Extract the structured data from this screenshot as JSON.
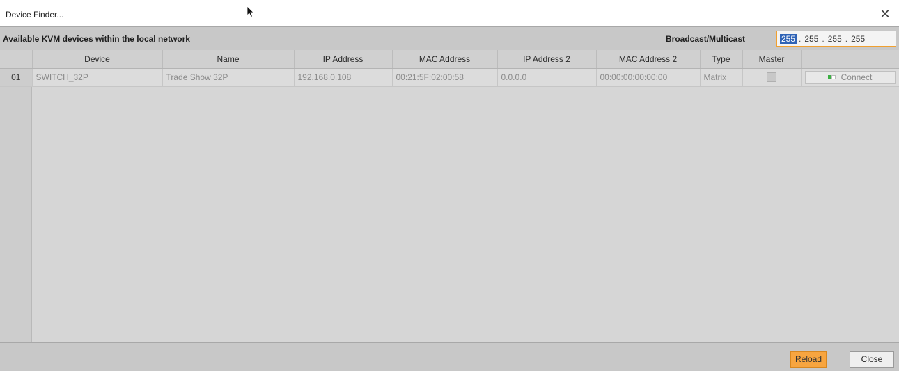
{
  "window": {
    "title": "Device Finder...",
    "close_symbol": "✕"
  },
  "header": {
    "title": "Available KVM devices within the local network",
    "broadcast_label": "Broadcast/Multicast",
    "broadcast_ip": {
      "octets": [
        "255",
        "255",
        "255",
        "255"
      ],
      "selected_octet": 0
    }
  },
  "table": {
    "columns": [
      "",
      "Device",
      "Name",
      "IP Address",
      "MAC Address",
      "IP Address 2",
      "MAC Address 2",
      "Type",
      "Master",
      ""
    ],
    "rows": [
      {
        "num": "01",
        "device": "SWITCH_32P",
        "name": "Trade Show 32P",
        "ip": "192.168.0.108",
        "mac": "00:21:5F:02:00:58",
        "ip2": "0.0.0.0",
        "mac2": "00:00:00:00:00:00",
        "type": "Matrix",
        "master": false,
        "action": "Connect"
      }
    ]
  },
  "footer": {
    "reload": "Reload",
    "close_first": "C",
    "close_rest": "lose"
  },
  "colors": {
    "accent_orange": "#f7a540",
    "selection_blue": "#2f63b6",
    "status_green": "#3cb043"
  }
}
